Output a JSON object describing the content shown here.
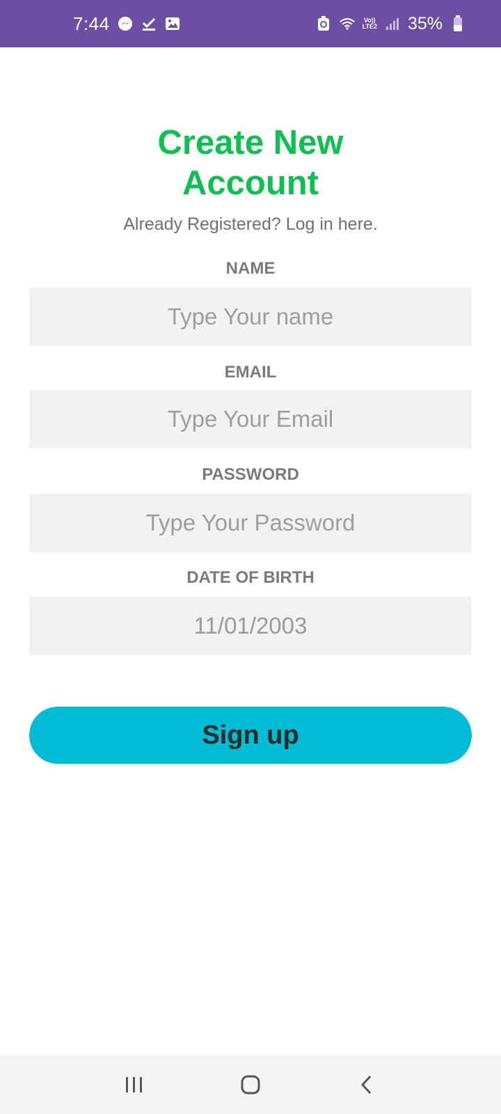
{
  "status_bar": {
    "time": "7:44",
    "battery": "35%",
    "network_top": "Vo))",
    "network_bottom": "LTE2",
    "icons": [
      "messenger-icon",
      "download-check-icon",
      "gallery-icon",
      "battery-saver-icon",
      "wifi-icon",
      "signal-icon",
      "battery-icon"
    ]
  },
  "form": {
    "title_line1": "Create New",
    "title_line2": "Account",
    "subtitle": "Already Registered? Log in here.",
    "fields": {
      "name": {
        "label": "NAME",
        "placeholder": "Type Your name",
        "value": ""
      },
      "email": {
        "label": "EMAIL",
        "placeholder": "Type Your Email",
        "value": ""
      },
      "password": {
        "label": "PASSWORD",
        "placeholder": "Type Your Password",
        "value": ""
      },
      "dob": {
        "label": "DATE OF BIRTH",
        "placeholder": "",
        "value": "11/01/2003"
      }
    },
    "submit_label": "Sign up"
  },
  "nav": {
    "icons": [
      "recent-apps-icon",
      "home-icon",
      "back-icon"
    ]
  },
  "colors": {
    "status_bar": "#6a4fa3",
    "title": "#0cc14f",
    "button": "#00bcd4",
    "input_bg": "#f2f2f2"
  }
}
